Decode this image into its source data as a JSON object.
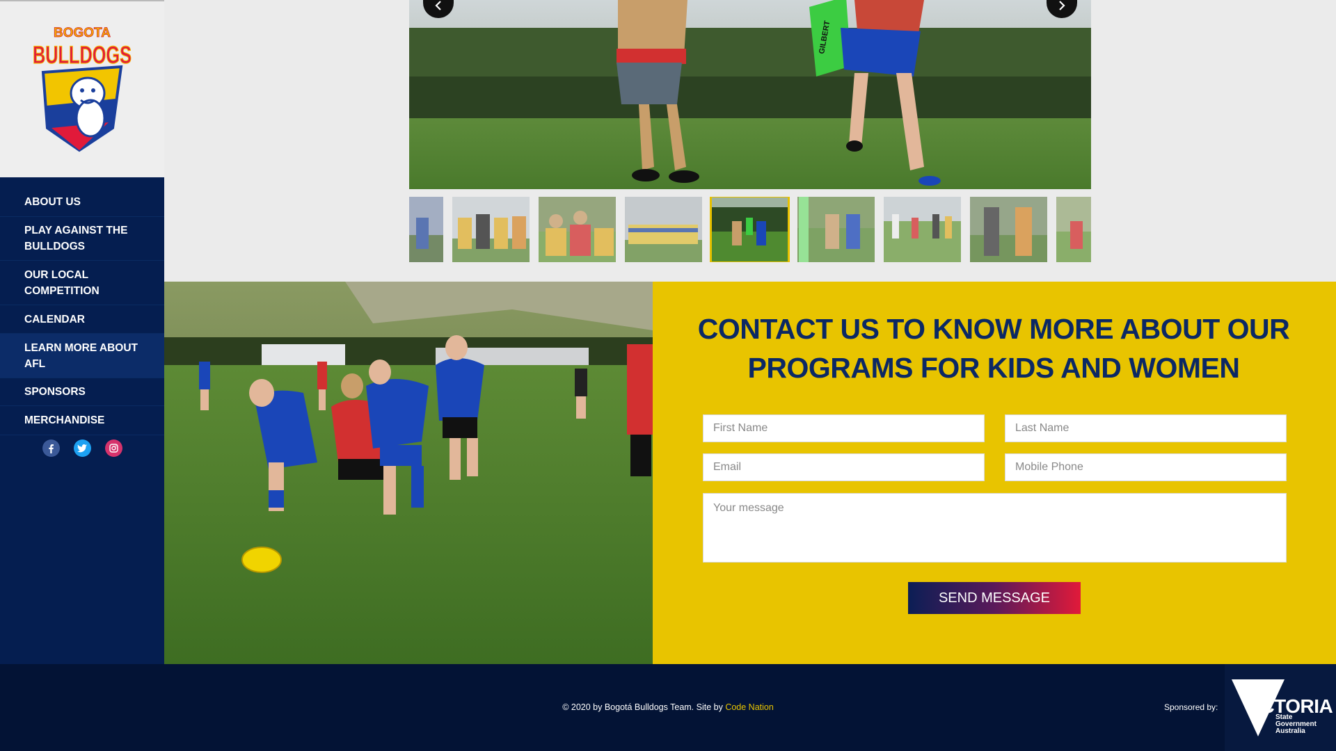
{
  "brand": {
    "logo_top": "BOGOTA",
    "logo_main": "BULLDOGS"
  },
  "nav": {
    "items": [
      {
        "label": "ABOUT US"
      },
      {
        "label": "PLAY AGAINST THE BULLDOGS"
      },
      {
        "label": "OUR LOCAL COMPETITION"
      },
      {
        "label": "CALENDAR"
      },
      {
        "label": "LEARN MORE ABOUT AFL"
      },
      {
        "label": "SPONSORS"
      },
      {
        "label": "MERCHANDISE"
      }
    ],
    "active_index": 4
  },
  "socials": [
    "facebook-icon",
    "twitter-icon",
    "instagram-icon"
  ],
  "gallery": {
    "thumb_count": 9,
    "selected_index": 4
  },
  "contact": {
    "heading": "CONTACT US TO KNOW MORE ABOUT OUR PROGRAMS FOR KIDS AND WOMEN",
    "first_name_placeholder": "First Name",
    "last_name_placeholder": "Last Name",
    "email_placeholder": "Email",
    "phone_placeholder": "Mobile Phone",
    "message_placeholder": "Your message",
    "send_label": "SEND MESSAGE"
  },
  "footer": {
    "copyright": "© 2020 by Bogotá Bulldogs Team. Site by ",
    "site_by_link": "Code Nation",
    "sponsored_by": "Sponsored by:",
    "sponsor_word": "VICTORIA",
    "sponsor_sub": "State Government Australia"
  },
  "colors": {
    "navy": "#051e50",
    "yellow": "#e8c400",
    "red": "#e11a3a"
  }
}
